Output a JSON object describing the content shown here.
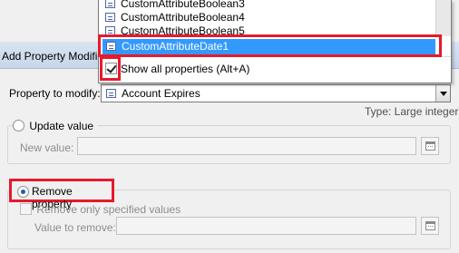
{
  "dialog": {
    "title": "Add Property Modific"
  },
  "dropdown_list": {
    "items": [
      {
        "label": "CustomAttributeBoolean3",
        "selected": false
      },
      {
        "label": "CustomAttributeBoolean4",
        "selected": false
      },
      {
        "label": "CustomAttributeBoolean5",
        "selected": false
      },
      {
        "label": "CustomAttributeDate1",
        "selected": true
      }
    ],
    "show_all_label": "Show all properties (Alt+A)",
    "show_all_checked": true
  },
  "form": {
    "property_label": "Property to modify:",
    "property_value": "Account Expires",
    "type_text": "Type: Large integer",
    "update_value_label": "Update value",
    "new_value_label": "New value:",
    "new_value": "",
    "remove_property_label": "Remove property",
    "remove_only_label": "Remove only specified values",
    "value_to_remove_label": "Value to remove:",
    "value_to_remove": ""
  },
  "colors": {
    "highlight": "#3399ff",
    "annotation": "#e8192c"
  },
  "icons": [
    "list-item-icon",
    "combo-icon",
    "calendar-icon",
    "dropdown-arrow-icon"
  ]
}
